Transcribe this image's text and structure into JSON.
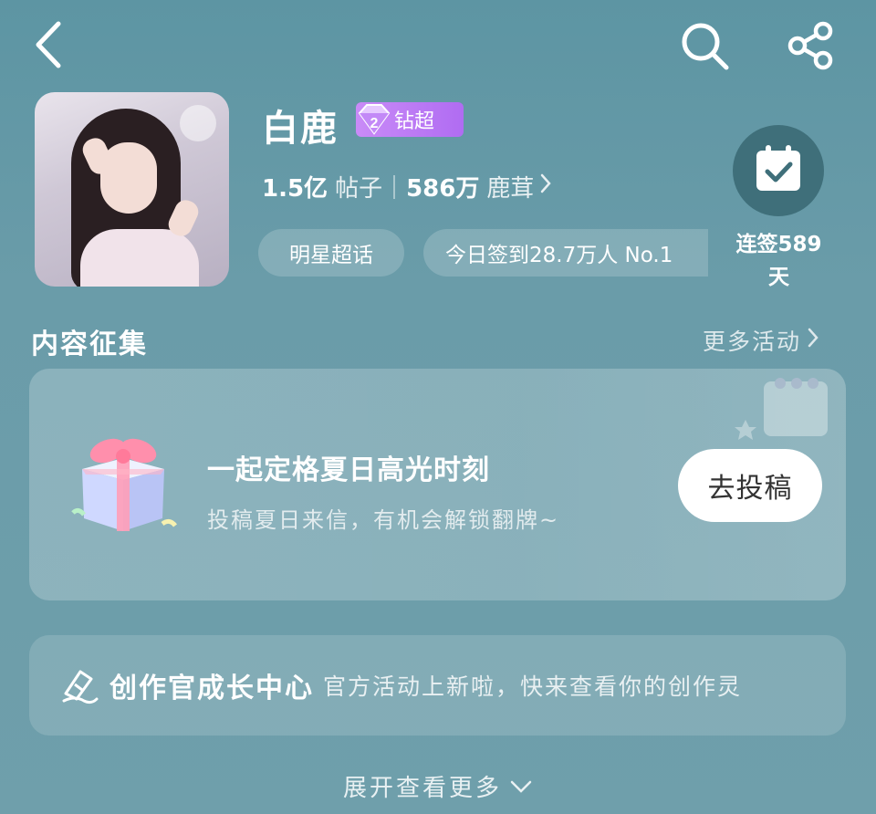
{
  "header": {
    "back_icon": "chevron-left-icon",
    "search_icon": "search-icon",
    "share_icon": "share-icon"
  },
  "profile": {
    "avatar_text": "白鹿",
    "title": "白鹿",
    "badge_label": "钻超",
    "stats": {
      "posts_value": "1.5亿",
      "posts_label": "帖子",
      "fans_value": "586万",
      "fans_label": "鹿茸"
    },
    "chips": [
      "明星超话",
      "今日签到28.7万人  No.1"
    ]
  },
  "checkin": {
    "icon": "calendar-check-icon",
    "label": "连签589天"
  },
  "section": {
    "title": "内容征集",
    "more_label": "更多活动"
  },
  "event": {
    "title": "一起定格夏日高光时刻",
    "subtitle": "投稿夏日来信，有机会解锁翻牌~",
    "button_label": "去投稿"
  },
  "creator": {
    "name": "创作官成长中心",
    "description": "官方活动上新啦，快来查看你的创作灵"
  },
  "expand_label": "展开查看更多",
  "colors": {
    "background": "#6a9ca9",
    "badge": "#b06cf2",
    "checkin_circle": "#3f6f7a"
  }
}
